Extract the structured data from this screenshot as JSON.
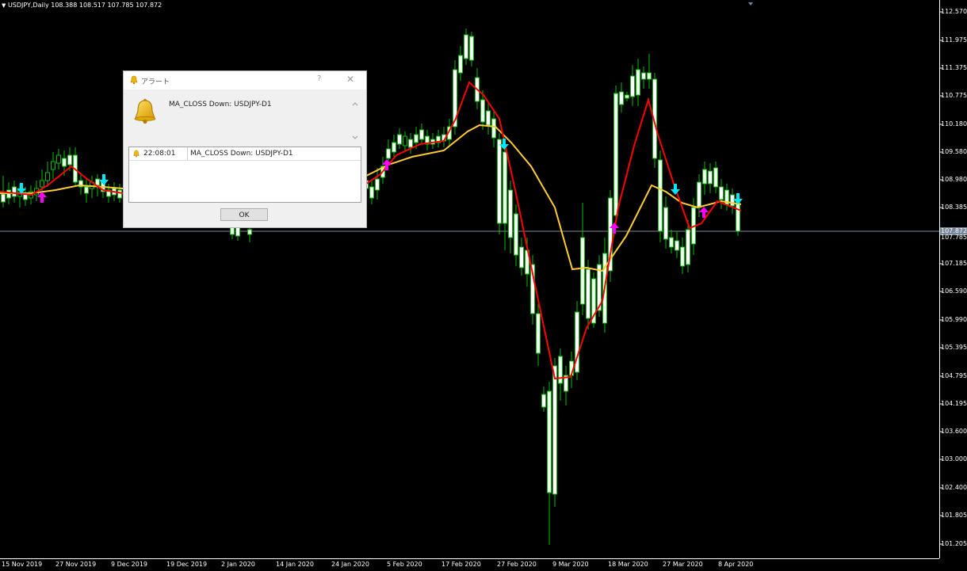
{
  "chart": {
    "symbol_info": "USDJPY,Daily  108.388 108.517 107.785 107.872",
    "current_price": "107.872",
    "current_low": "107.785",
    "colors": {
      "bull_candle": "#00c000",
      "bear_candle": "#ffffff",
      "ma_fast": "#ff0000",
      "ma_slow": "#ffcc33",
      "signal_up": "#ff00ff",
      "signal_down": "#00e5ff",
      "price_line": "#778899"
    }
  },
  "chart_data": {
    "type": "candlestick",
    "price_ticks": [
      "112.570",
      "111.975",
      "111.375",
      "110.775",
      "110.180",
      "109.580",
      "108.980",
      "108.385",
      "107.185",
      "106.590",
      "105.990",
      "105.395",
      "104.795",
      "104.195",
      "103.600",
      "103.000",
      "102.400",
      "101.805",
      "101.205"
    ],
    "date_ticks": [
      "15 Nov 2019",
      "27 Nov 2019",
      "9 Dec 2019",
      "19 Dec 2019",
      "2 Jan 2020",
      "14 Jan 2020",
      "24 Jan 2020",
      "5 Feb 2020",
      "17 Feb 2020",
      "27 Feb 2020",
      "9 Mar 2020",
      "18 Mar 2020",
      "27 Mar 2020",
      "8 Apr 2020"
    ]
  },
  "dialog": {
    "title": "アラート",
    "help": "?",
    "close": "✕",
    "message": "MA_CLOSS Down: USDJPY-D1",
    "list": [
      {
        "time": "22:08:01",
        "message": "MA_CLOSS Down: USDJPY-D1"
      }
    ],
    "ok_label": "OK"
  }
}
